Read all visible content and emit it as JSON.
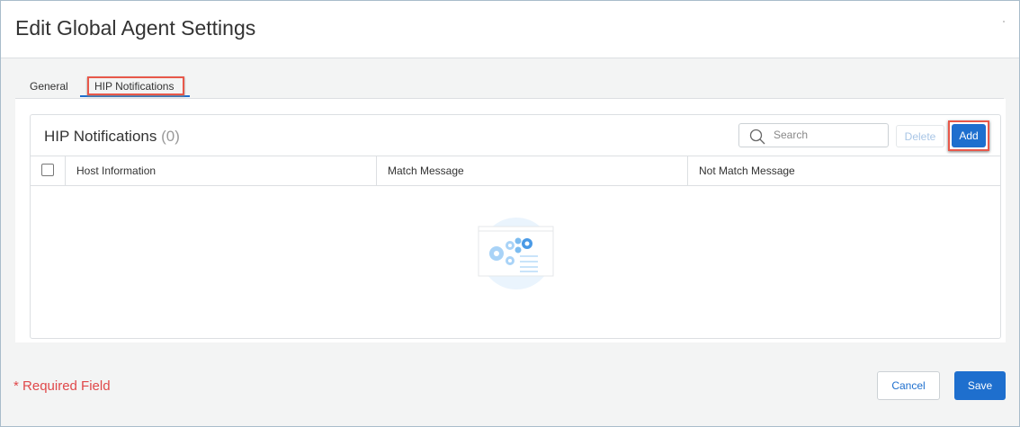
{
  "dialog": {
    "title": "Edit Global Agent Settings"
  },
  "tabs": [
    {
      "label": "General"
    },
    {
      "label": "HIP Notifications",
      "active": true
    }
  ],
  "card": {
    "title": "HIP Notifications",
    "count": "(0)",
    "search_placeholder": "Search",
    "delete_label": "Delete",
    "add_label": "Add",
    "columns": [
      "Host Information",
      "Match Message",
      "Not Match Message"
    ]
  },
  "footer": {
    "required_label": "Required Field",
    "required_mark": "*",
    "cancel_label": "Cancel",
    "save_label": "Save"
  },
  "colors": {
    "primary": "#1e6fce",
    "highlight": "#e8584a",
    "required": "#e0484a"
  }
}
